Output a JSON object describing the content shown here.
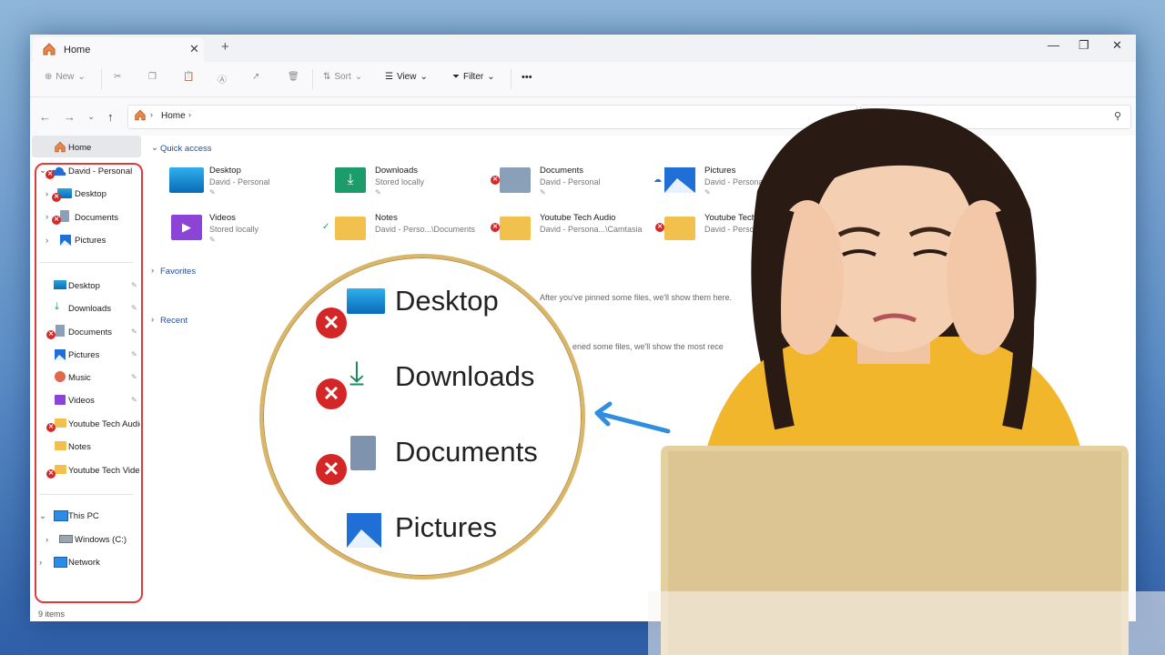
{
  "tab": {
    "title": "Home",
    "close": "✕",
    "new": "+"
  },
  "window_controls": {
    "minimize": "—",
    "maximize": "❐",
    "close": "✕"
  },
  "toolbar": {
    "new_label": "New",
    "sort_label": "Sort",
    "view_label": "View",
    "filter_label": "Filter",
    "more_label": "•••"
  },
  "address": {
    "path_label": "Home"
  },
  "sidebar": {
    "home": "Home",
    "onedrive": "David - Personal",
    "onedrive_children": [
      "Desktop",
      "Documents",
      "Pictures"
    ],
    "pinned": [
      "Desktop",
      "Downloads",
      "Documents",
      "Pictures",
      "Music",
      "Videos",
      "Youtube Tech Audio",
      "Notes",
      "Youtube Tech Video"
    ],
    "this_pc": "This PC",
    "windows_c": "Windows (C:)",
    "network": "Network"
  },
  "sections": {
    "quick_access": "Quick access",
    "favorites": "Favorites",
    "recent": "Recent"
  },
  "quick_access_items": [
    {
      "name": "Desktop",
      "sub": "David - Personal"
    },
    {
      "name": "Downloads",
      "sub": "Stored locally"
    },
    {
      "name": "Documents",
      "sub": "David - Personal"
    },
    {
      "name": "Pictures",
      "sub": "David - Personal"
    },
    {
      "name": "Videos",
      "sub": "Stored locally"
    },
    {
      "name": "Notes",
      "sub": "David - Perso...\\Documents"
    },
    {
      "name": "Youtube Tech Audio",
      "sub": "David - Persona...\\Camtasia"
    },
    {
      "name": "Youtube Tech Videos",
      "sub": "David - Persona...\\Cam"
    }
  ],
  "hints": {
    "favorites": "After you've pinned some files, we'll show them here.",
    "recent": "ened some files, we'll show the most rece"
  },
  "status": {
    "items": "9 items"
  },
  "zoom": {
    "items": [
      "Desktop",
      "Downloads",
      "Documents",
      "Pictures"
    ]
  },
  "colors": {
    "error_red": "#d42626",
    "frame_red": "#e03a3a",
    "accent_blue": "#1f4e99",
    "gold_ring": "#d8b66a"
  }
}
